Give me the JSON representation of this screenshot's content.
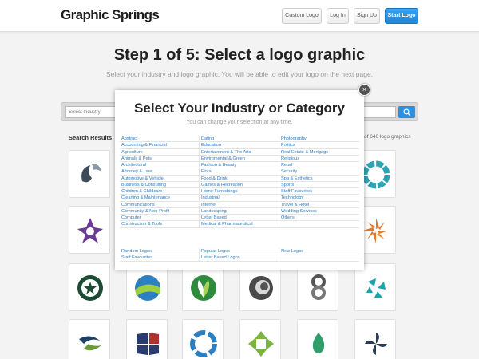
{
  "header": {
    "logo": "Graphic Springs",
    "buttons": [
      "Custom Logo",
      "Log In",
      "Sign Up",
      "Start Logo"
    ]
  },
  "page": {
    "title": "Step 1 of 5: Select a logo graphic",
    "subtitle": "Select your industry and logo graphic. You will be able to edit your logo on the next page."
  },
  "search": {
    "placeholder": "Select Industry"
  },
  "results": {
    "label": "Search Results",
    "count": "of 640 logo graphics"
  },
  "modal": {
    "title": "Select Your Industry or Category",
    "subtitle": "You can change your selection at any time.",
    "close": "×",
    "col1": [
      "Abstract",
      "Accounting & Financial",
      "Agriculture",
      "Animals & Pets",
      "Architectural",
      "Attorney & Law",
      "Automotive & Vehicle",
      "Business & Consulting",
      "Children & Childcare",
      "Cleaning & Maintenance",
      "Communications",
      "Community & Non-Profit",
      "Computer",
      "Construction & Tools"
    ],
    "col2": [
      "Dating",
      "Education",
      "Entertainment & The Arts",
      "Enviromental & Green",
      "Fashion & Beauty",
      "Floral",
      "Food & Drink",
      "Games & Recreation",
      "Home Furnishings",
      "Industrial",
      "Internet",
      "Landscaping",
      "Letter Based",
      "Medical & Pharmaceutical"
    ],
    "col3": [
      "Photography",
      "Politics",
      "Real Estate & Mortgage",
      "Religious",
      "Retail",
      "Security",
      "Spa & Esthetics",
      "Sports",
      "Staff Favourites",
      "Technology",
      "Travel & Hotel",
      "Wedding Services",
      "Others",
      ""
    ],
    "extra1": [
      "Random Logos",
      "Staff Favourites"
    ],
    "extra2": [
      "Popular Logos",
      "Letter Based Logos"
    ],
    "extra3": [
      "New Logos",
      ""
    ]
  },
  "colors": {
    "accent": "#2b7dc8",
    "primary_button": "#1d86d6",
    "link": "#2b7dc8"
  }
}
